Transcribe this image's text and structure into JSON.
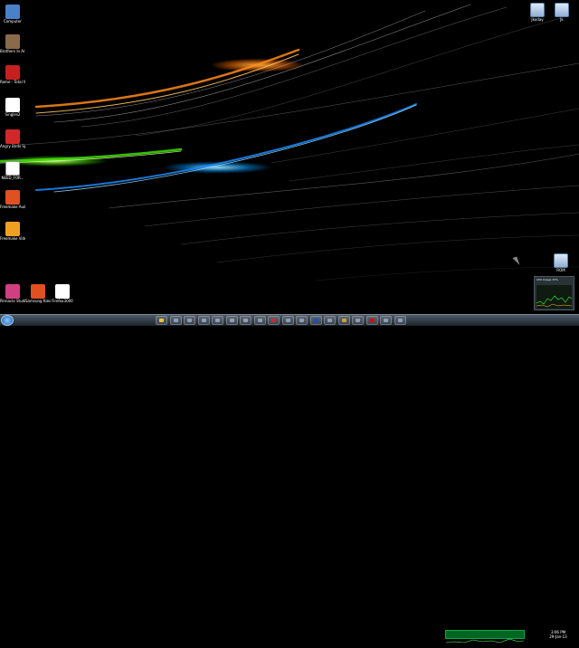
{
  "desktop": {
    "icons_left": [
      {
        "id": "computer",
        "label": "Computer",
        "icon": "computer-icon",
        "color": "#4a80c8"
      },
      {
        "id": "brothers",
        "label": "Brothers In Arms",
        "icon": "game-icon",
        "color": "#8a6a4a"
      },
      {
        "id": "rome",
        "label": "Rome - Total War",
        "icon": "game-icon",
        "color": "#c42020"
      },
      {
        "id": "singles2",
        "label": "Singles2",
        "icon": "heart-icon",
        "color": "#ffffff"
      },
      {
        "id": "angrybirds",
        "label": "Angry Birds Space",
        "icon": "bird-icon",
        "color": "#d02828"
      },
      {
        "id": "needfor",
        "label": "NEED_FOR...",
        "icon": "document-icon",
        "color": "#ffffff"
      },
      {
        "id": "freemakeaudio",
        "label": "Freemake Audio C...",
        "icon": "freemake-audio-icon",
        "color": "#e05020"
      },
      {
        "id": "freemakevideo",
        "label": "Freemake Video C...",
        "icon": "freemake-video-icon",
        "color": "#f0a020"
      }
    ],
    "icons_bottom": [
      {
        "id": "pinnacle",
        "label": "Pinnacle Studio 15",
        "icon": "pinnacle-icon",
        "color": "#d04080"
      },
      {
        "id": "samsungkies",
        "label": "Samsung Kies",
        "icon": "kies-icon",
        "color": "#e05020"
      },
      {
        "id": "firefox",
        "label": "Firefox3000",
        "icon": "fox-icon",
        "color": "#ffffff"
      }
    ],
    "icons_right": [
      {
        "id": "jkoday",
        "label": "Jkoday",
        "icon": "folder-icon"
      },
      {
        "id": "jk",
        "label": "Jk",
        "icon": "folder-icon"
      },
      {
        "id": "rom",
        "label": "ROM",
        "icon": "folder-icon"
      }
    ]
  },
  "gadget": {
    "label": "CPU Usage 33%"
  },
  "taskbar": {
    "buttons": [
      {
        "id": "explorer",
        "icon": "explorer-icon",
        "color": "#f0c040"
      },
      {
        "id": "app2",
        "icon": "window-icon",
        "color": "#8aa0b8"
      },
      {
        "id": "app3",
        "icon": "window-icon",
        "color": "#8aa0b8"
      },
      {
        "id": "app4",
        "icon": "window-icon",
        "color": "#8aa0b8"
      },
      {
        "id": "app5",
        "icon": "media-icon",
        "color": "#8aa0b8"
      },
      {
        "id": "app6",
        "icon": "chart-icon",
        "color": "#8aa0b8"
      },
      {
        "id": "app7",
        "icon": "image-icon",
        "color": "#8aa0b8"
      },
      {
        "id": "app8",
        "icon": "window-icon",
        "color": "#8aa0b8"
      },
      {
        "id": "app9",
        "icon": "game-icon",
        "color": "#c03030"
      },
      {
        "id": "app10",
        "icon": "window-icon",
        "color": "#8aa0b8"
      },
      {
        "id": "app11",
        "icon": "network-icon",
        "color": "#8aa0b8"
      },
      {
        "id": "app12",
        "icon": "flag-icon",
        "color": "#2050c0"
      },
      {
        "id": "app13",
        "icon": "window-icon",
        "color": "#8aa0b8"
      },
      {
        "id": "app14",
        "icon": "window-icon",
        "color": "#c8a040"
      },
      {
        "id": "app15",
        "icon": "window-icon",
        "color": "#8aa0b8"
      },
      {
        "id": "app16",
        "icon": "opera-icon",
        "color": "#d01010"
      },
      {
        "id": "app17",
        "icon": "window-icon",
        "color": "#8aa0b8"
      },
      {
        "id": "app18",
        "icon": "window-icon",
        "color": "#8aa0b8"
      }
    ],
    "clock": {
      "time": "3:06 PM",
      "date": "29-Jan-13"
    }
  }
}
